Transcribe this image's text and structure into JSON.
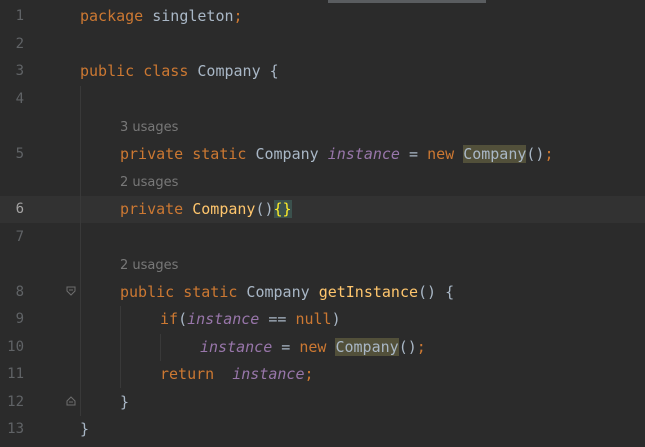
{
  "line_numbers": [
    "1",
    "2",
    "3",
    "4",
    "5",
    "6",
    "7",
    "8",
    "9",
    "10",
    "11",
    "12",
    "13"
  ],
  "code": {
    "l1": {
      "kw": "package",
      "rest": " singleton",
      "semi": ";"
    },
    "l3": {
      "kw": "public class",
      "cls": " Company ",
      "brace": "{"
    },
    "hint5": "3 usages",
    "l5": {
      "kw": "private static",
      "type": " Company ",
      "field": "instance",
      "eq": " = ",
      "new": "new",
      "sp": " ",
      "ctor": "Company",
      "tail": "()",
      "semi": ";"
    },
    "hint6": "2 usages",
    "l6": {
      "kw": "private",
      "sp": " ",
      "ctor": "Company",
      "paren": "()",
      "braces": "{}"
    },
    "hint8": "2 usages",
    "l8": {
      "kw": "public static",
      "type": " Company ",
      "fn": "getInstance",
      "tail": "() {"
    },
    "l9": {
      "kw": "if",
      "open": "(",
      "field": "instance",
      "op": " == ",
      "null": "null",
      "close": ")"
    },
    "l10": {
      "field": "instance",
      "eq": " = ",
      "new": "new",
      "sp": " ",
      "ctor": "Company",
      "tail": "()",
      "semi": ";"
    },
    "l11": {
      "kw": "return",
      "sp": "  ",
      "field": "instance",
      "semi": ";"
    },
    "l12": "}",
    "l13": "}"
  }
}
